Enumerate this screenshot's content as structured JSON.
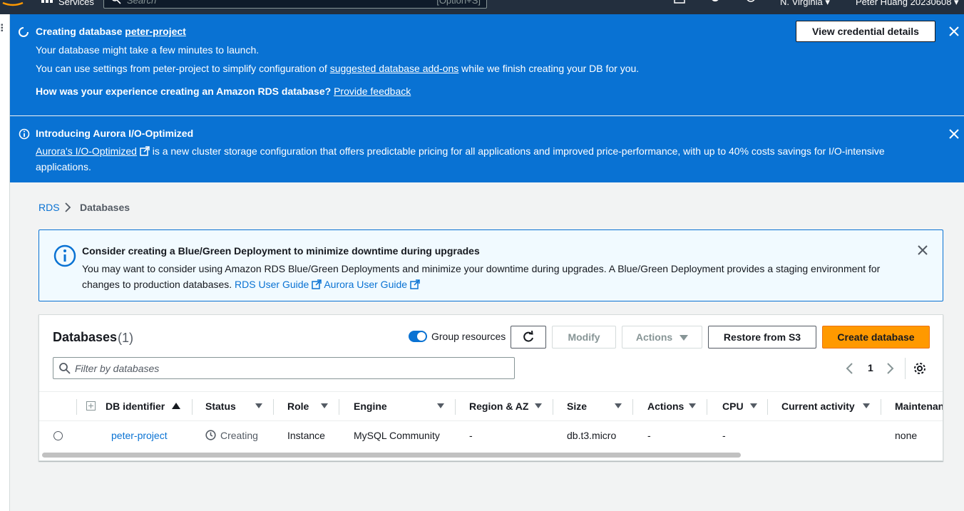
{
  "topnav": {
    "services_label": "Services",
    "search_placeholder": "Search",
    "search_shortcut": "[Option+S]",
    "region": "N. Virginia ▾",
    "user": "Peter Huang 20230608 ▾"
  },
  "flash_creating": {
    "title_prefix": "Creating database ",
    "title_link": "peter-project",
    "line1": "Your database might take a few minutes to launch.",
    "line2_prefix": "You can use settings from peter-project to simplify configuration of ",
    "line2_link": "suggested database add-ons",
    "line2_suffix": " while we finish creating your DB for you.",
    "feedback_prefix": "How was your experience creating an Amazon RDS database? ",
    "feedback_link": "Provide feedback",
    "button": "View credential details"
  },
  "flash_aurora": {
    "title": "Introducing Aurora I/O-Optimized",
    "link": "Aurora's I/O-Optimized",
    "body_line1": " is a new cluster storage configuration that offers predictable pricing for all applications and improved price-performance, with up to 40% costs savings for I/O-intensive",
    "body_line2": "applications."
  },
  "breadcrumb": {
    "root": "RDS",
    "current": "Databases"
  },
  "alert": {
    "title": "Consider creating a Blue/Green Deployment to minimize downtime during upgrades",
    "body": "You may want to consider using Amazon RDS Blue/Green Deployments and minimize your downtime during upgrades. A Blue/Green Deployment provides a staging environment for changes to production databases. ",
    "link1": "RDS User Guide",
    "link2": "Aurora User Guide"
  },
  "panel": {
    "title": "Databases",
    "count": "(1)",
    "group_label": "Group resources",
    "modify": "Modify",
    "actions": "Actions",
    "restore": "Restore from S3",
    "create": "Create database",
    "filter_placeholder": "Filter by databases",
    "page": "1"
  },
  "table": {
    "columns": [
      "DB identifier",
      "Status",
      "Role",
      "Engine",
      "Region & AZ",
      "Size",
      "Actions",
      "CPU",
      "Current activity",
      "Maintenan"
    ],
    "row": {
      "identifier": "peter-project",
      "status": "Creating",
      "role": "Instance",
      "engine": "MySQL Community",
      "region": "-",
      "size": "db.t3.micro",
      "actions": "-",
      "cpu": "-",
      "activity": "",
      "maintenance": "none"
    }
  },
  "colors": {
    "flash_blue": "#0972d3",
    "primary_orange": "#ff9900",
    "nav_dark": "#232f3e",
    "link_blue": "#0972d3"
  }
}
